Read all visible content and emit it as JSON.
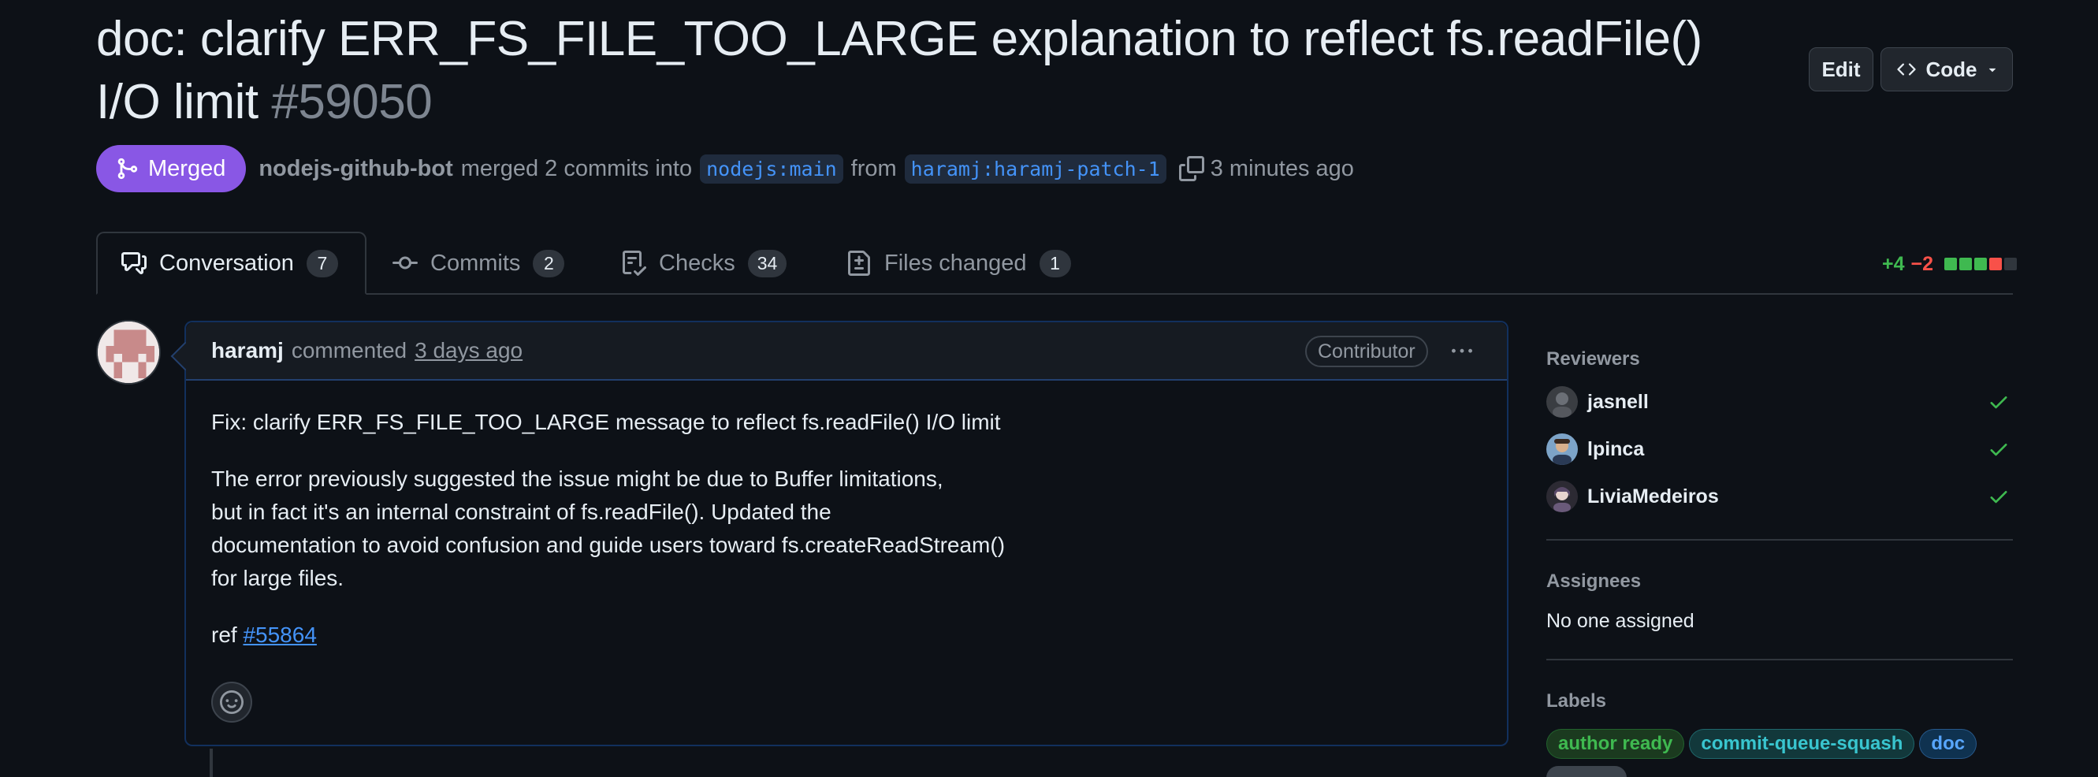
{
  "pr": {
    "title_text": "doc: clarify ERR_FS_FILE_TOO_LARGE explanation to reflect fs.readFile() I/O limit",
    "number": "#59050",
    "state": "Merged",
    "author": "nodejs-github-bot",
    "merge_text": "merged 2 commits into",
    "base_branch": "nodejs:main",
    "from_text": "from",
    "head_branch": "haramj:haramj-patch-1",
    "time": "3 minutes ago"
  },
  "header": {
    "edit_label": "Edit",
    "code_label": "Code"
  },
  "tabs": [
    {
      "label": "Conversation",
      "count": "7",
      "icon": "comment-discussion-icon"
    },
    {
      "label": "Commits",
      "count": "2",
      "icon": "git-commit-icon"
    },
    {
      "label": "Checks",
      "count": "34",
      "icon": "checklist-icon"
    },
    {
      "label": "Files changed",
      "count": "1",
      "icon": "file-diff-icon"
    }
  ],
  "diffstat": {
    "additions": "+4",
    "deletions": "−2"
  },
  "comment": {
    "author": "haramj",
    "action": "commented",
    "time": "3 days ago",
    "badge": "Contributor",
    "body_line1": "Fix: clarify ERR_FS_FILE_TOO_LARGE message to reflect fs.readFile() I/O limit",
    "body_para2": [
      "The error previously suggested the issue might be due to Buffer limitations,",
      "but in fact it's an internal constraint of fs.readFile(). Updated the",
      "documentation to avoid confusion and guide users toward fs.createReadStream()",
      "for large files."
    ],
    "ref_prefix": "ref",
    "ref_link": "#55864"
  },
  "sidebar": {
    "reviewers_title": "Reviewers",
    "reviewers": [
      {
        "name": "jasnell",
        "status": "approved"
      },
      {
        "name": "lpinca",
        "status": "approved"
      },
      {
        "name": "LiviaMedeiros",
        "status": "approved"
      }
    ],
    "assignees_title": "Assignees",
    "assignees_value": "No one assigned",
    "labels_title": "Labels",
    "labels": [
      {
        "name": "author ready",
        "color": "#3fb950"
      },
      {
        "name": "commit-queue-squash",
        "color": "#39c5cf"
      },
      {
        "name": "doc",
        "color": "#58a6ff"
      }
    ]
  },
  "colors": {
    "merged": "#8957e5",
    "link": "#4493f8",
    "approved": "#3fb950"
  }
}
